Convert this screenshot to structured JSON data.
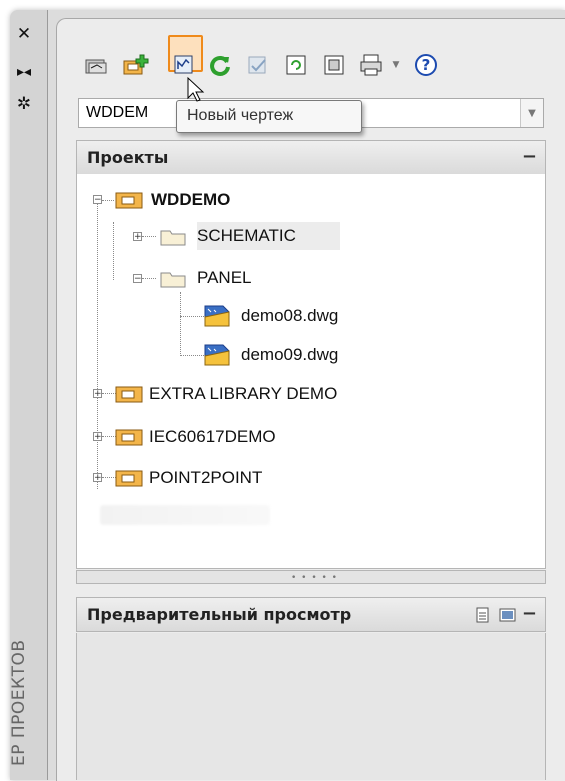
{
  "palette": {
    "vertical_title": "ЕР ПРОЕКТОВ",
    "strip_icons": [
      "close-icon",
      "auto-hide-icon",
      "properties-icon"
    ]
  },
  "toolbar": {
    "buttons": [
      "open-project-icon",
      "new-project-icon",
      "new-drawing-icon",
      "refresh-icon",
      "update-icon",
      "project-properties-icon",
      "drawing-list-report-icon",
      "plot-icon",
      "help-icon"
    ],
    "highlighted": "new-drawing-icon"
  },
  "project_selector": {
    "value": "WDDEM",
    "tooltip": "Новый чертеж"
  },
  "projects_panel": {
    "title": "Проекты",
    "collapse": "−"
  },
  "tree": {
    "root": "WDDEMO",
    "folders": [
      "SCHEMATIC",
      "PANEL"
    ],
    "files": [
      "demo08.dwg",
      "demo09.dwg"
    ],
    "other_projects": [
      "EXTRA LIBRARY DEMO",
      "IEC60617DEMO",
      "POINT2POINT"
    ]
  },
  "preview_panel": {
    "title": "Предварительный просмотр",
    "collapse": "−"
  },
  "colors": {
    "highlight_border": "#ef8a1b",
    "panel_bg": "#ececec",
    "accent_blue": "#1d4bb0"
  }
}
